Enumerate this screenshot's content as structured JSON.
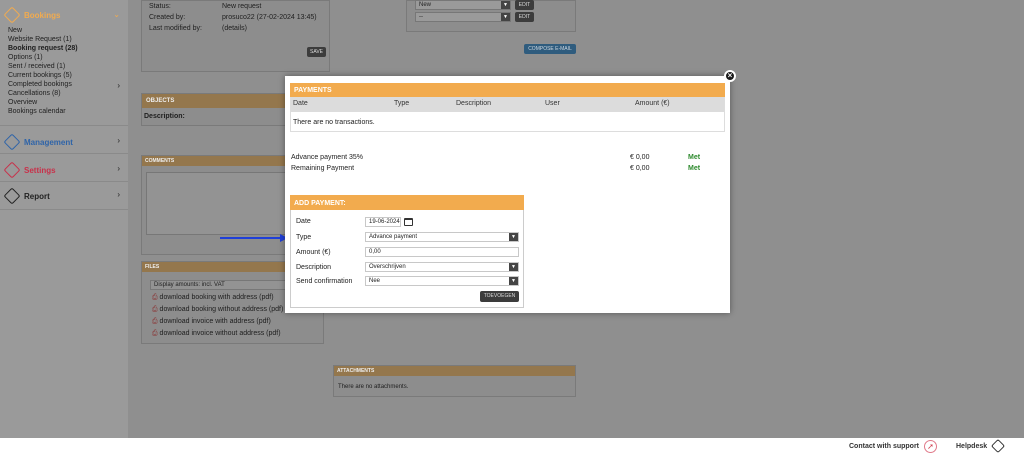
{
  "sidebar": {
    "bookings": {
      "title": "Bookings",
      "items": [
        "New",
        "Website Request (1)",
        "Booking request (28)",
        "Options (1)",
        "Sent / received (1)",
        "Current bookings (5)",
        "Completed bookings",
        "Cancellations (8)",
        "Overview",
        "Bookings calendar"
      ]
    },
    "management": "Management",
    "settings": "Settings",
    "report": "Report",
    "colors": {
      "bookings": "#f2ab4e",
      "management": "#2f64a8",
      "settings": "#c8304a",
      "report": "#333333"
    }
  },
  "details": {
    "status_label": "Status:",
    "status_value": "New request",
    "created_label": "Created by:",
    "created_value": "prosuco22 (27-02-2024 13:45)",
    "modified_label": "Last modified by:",
    "modified_value": "(details)",
    "save": "SAVE"
  },
  "top_right": {
    "select1": "New",
    "select2": "--",
    "edit": "EDIT",
    "compose": "COMPOSE E-MAIL"
  },
  "objects": {
    "title": "OBJECTS",
    "description_label": "Description:"
  },
  "comments": {
    "title": "COMMENTS"
  },
  "files": {
    "title": "FILES",
    "amounts_select": "Display amounts: incl. VAT",
    "links": [
      "download booking with address (pdf)",
      "download booking without address (pdf)",
      "download invoice with address (pdf)",
      "download invoice without address (pdf)"
    ]
  },
  "attachments": {
    "title": "ATTACHMENTS",
    "empty": "There are no attachments."
  },
  "payments": {
    "title": "PAYMENTS",
    "columns": [
      "Date",
      "Type",
      "Description",
      "User",
      "Amount (€)"
    ],
    "empty": "There are no transactions.",
    "summary": [
      {
        "label": "Advance payment 35%",
        "amount": "€ 0,00",
        "status": "Met"
      },
      {
        "label": "Remaining Payment",
        "amount": "€ 0,00",
        "status": "Met"
      }
    ]
  },
  "add_payment": {
    "title": "ADD PAYMENT:",
    "date_label": "Date",
    "date_value": "19-06-2024",
    "type_label": "Type",
    "type_value": "Advance payment",
    "amount_label": "Amount (€)",
    "amount_value": "0,00",
    "description_label": "Description",
    "description_value": "Overschrijven",
    "confirm_label": "Send confirmation",
    "confirm_value": "Nee",
    "submit": "TOEVOEGEN"
  },
  "footer": {
    "support": "Contact with support",
    "helpdesk": "Helpdesk"
  },
  "accent": "#f2ab4e",
  "arrow_color": "#1f3fd8"
}
